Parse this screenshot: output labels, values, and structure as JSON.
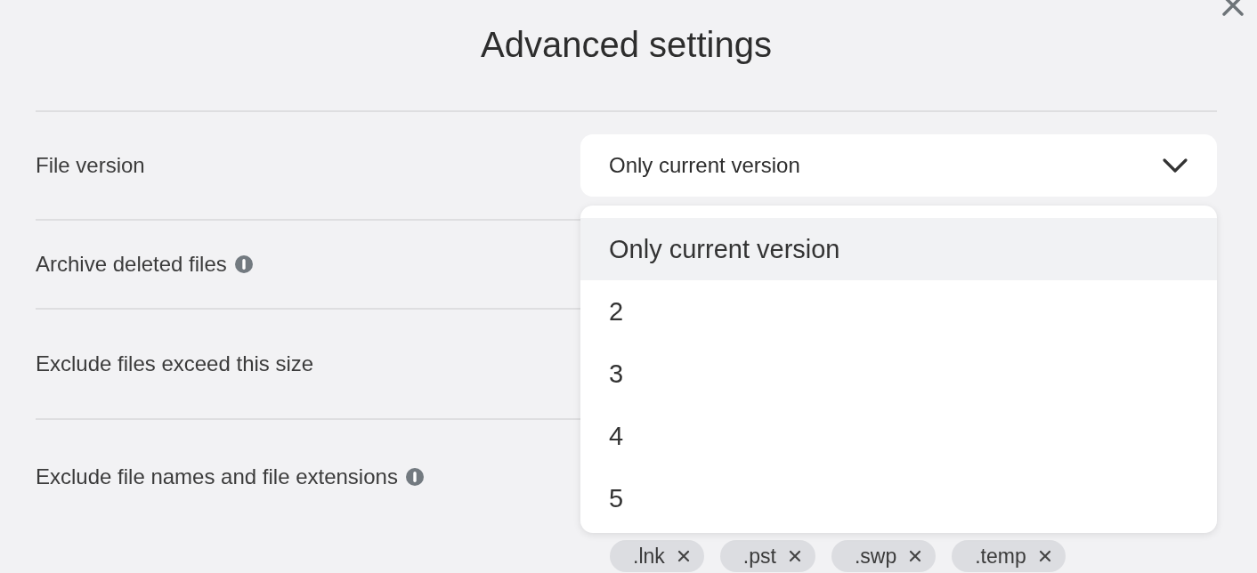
{
  "dialog": {
    "title": "Advanced settings"
  },
  "settings": [
    {
      "kind": "select",
      "label": "File version",
      "info": false
    },
    {
      "kind": "plain",
      "label": "Archive deleted files",
      "info": true
    },
    {
      "kind": "plain",
      "label": "Exclude files exceed this size",
      "info": false
    },
    {
      "kind": "tags",
      "label": "Exclude file names and file extensions",
      "info": true
    }
  ],
  "file_version_select": {
    "value": "Only current version",
    "expanded": true,
    "options": [
      {
        "label": "Only current version",
        "selected": true
      },
      {
        "label": "2",
        "selected": false
      },
      {
        "label": "3",
        "selected": false
      },
      {
        "label": "4",
        "selected": false
      },
      {
        "label": "5",
        "selected": false
      }
    ]
  },
  "excluded_extensions": [
    ".lnk",
    ".pst",
    ".swp",
    ".temp"
  ]
}
